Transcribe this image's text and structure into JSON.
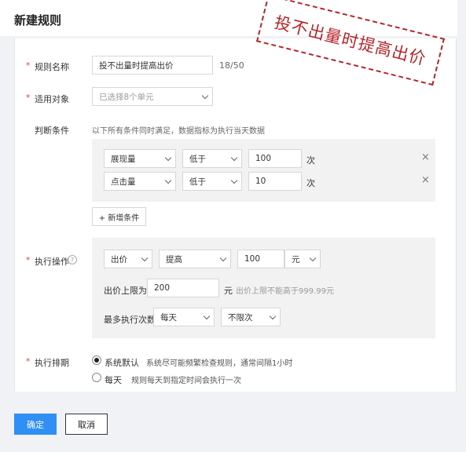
{
  "page": {
    "title": "新建规则"
  },
  "stamp": {
    "text": "投不出量时提高出价"
  },
  "form": {
    "required_mark": "*",
    "rule_name": {
      "label": "规则名称",
      "value": "投不出量时提高出价",
      "count": "18/50"
    },
    "target": {
      "label": "适用对象",
      "placeholder": "已选择8个单元"
    },
    "condition": {
      "label": "判断条件",
      "hint": "以下所有条件同时满足，数据指标为执行当天数据",
      "rows": [
        {
          "metric": "展现量",
          "operator": "低于",
          "value": "100",
          "unit": "次",
          "remove": "×"
        },
        {
          "metric": "点击量",
          "operator": "低于",
          "value": "10",
          "unit": "次",
          "remove": "×"
        }
      ],
      "add_label": "+ 新增条件"
    },
    "action": {
      "label": "执行操作",
      "help": "?",
      "target": "出价",
      "op": "提高",
      "value": "100",
      "unit": "元",
      "limit_label": "出价上限为",
      "limit_value": "200",
      "limit_unit": "元",
      "limit_hint": "出价上限不能高于999.99元",
      "max_label": "最多执行次数",
      "freq": "每天",
      "times": "不限次"
    },
    "schedule": {
      "label": "执行排期",
      "options": [
        {
          "label": "系统默认",
          "desc": "系统尽可能频繁检查规则，通常间隔1小时",
          "selected": true
        },
        {
          "label": "每天",
          "desc": "规则每天到指定时间会执行一次",
          "selected": false
        }
      ]
    }
  },
  "buttons": {
    "confirm": "确定",
    "cancel": "取消"
  },
  "colors": {
    "primary": "#2f8ff5",
    "required": "#e54545",
    "stamp": "#b3262b"
  }
}
